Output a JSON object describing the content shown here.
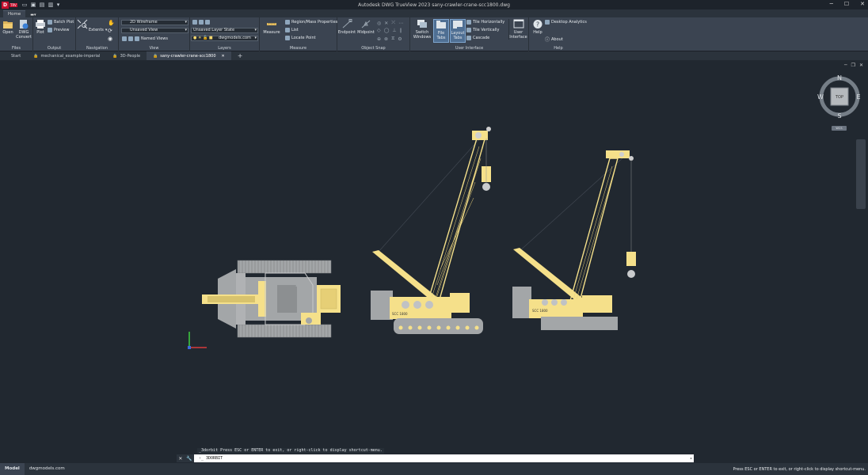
{
  "titlebar": {
    "app_badge": "D",
    "app_badge_sub": "TRV",
    "title": "Autodesk DWG TrueView 2023    sany-crawler-crane-scc1800.dwg"
  },
  "ribbon_tabs": [
    {
      "label": "Home",
      "active": true
    }
  ],
  "panels": {
    "files": {
      "label": "Files",
      "open": "Open",
      "convert": "DWG Convert"
    },
    "output": {
      "label": "Output",
      "plot": "Plot",
      "batch_plot": "Batch Plot",
      "preview": "Preview"
    },
    "navigation": {
      "label": "Navigation",
      "extents": "Extents"
    },
    "view": {
      "label": "View",
      "visual_style": "2D Wireframe",
      "named_view": "Unsaved View",
      "named_views": "Named Views"
    },
    "layers": {
      "label": "Layers",
      "layer_state": "Unsaved Layer State",
      "current_layer": "dwgmodels.com"
    },
    "measure": {
      "label": "Measure",
      "measure": "Measure",
      "region": "Region/Mass Properties",
      "list": "List",
      "locate_point": "Locate Point"
    },
    "osnap": {
      "label": "Object Snap",
      "endpoint": "Endpoint",
      "midpoint": "Midpoint"
    },
    "ui": {
      "label": "User Interface",
      "switch_windows": "Switch Windows",
      "file_tabs": "File Tabs",
      "layout_tabs": "Layout Tabs",
      "tile_h": "Tile Horizontally",
      "tile_v": "Tile Vertically",
      "cascade": "Cascade",
      "user_interface": "User Interface"
    },
    "help": {
      "label": "Help",
      "help": "Help",
      "desktop_analytics": "Desktop Analytics",
      "about": "About"
    }
  },
  "doc_tabs": [
    {
      "label": "Start",
      "lock": false,
      "active": false
    },
    {
      "label": "mechanical_example-imperial",
      "lock": true,
      "active": false
    },
    {
      "label": "3D-People",
      "lock": true,
      "active": false
    },
    {
      "label": "sany-crawler-crane-scc1800",
      "lock": true,
      "active": true
    }
  ],
  "viewcube": {
    "north": "N",
    "south": "S",
    "east": "E",
    "west": "W",
    "face": "TOP",
    "wcs": "WCS"
  },
  "crane_label": "SCC 1800",
  "command": {
    "history": "_3dorbit Press ESC or ENTER to exit, or right-click to display shortcut-menu.",
    "current": "3DORBIT"
  },
  "status_tabs": [
    {
      "label": "Model",
      "active": true
    },
    {
      "label": "dwgmodels.com",
      "active": false
    }
  ],
  "status_message": "Press ESC or ENTER to exit, or right-click to display shortcut-menu.",
  "colors": {
    "crane": "#f5e08a",
    "steel": "#a3a6a8",
    "background": "#212830"
  }
}
